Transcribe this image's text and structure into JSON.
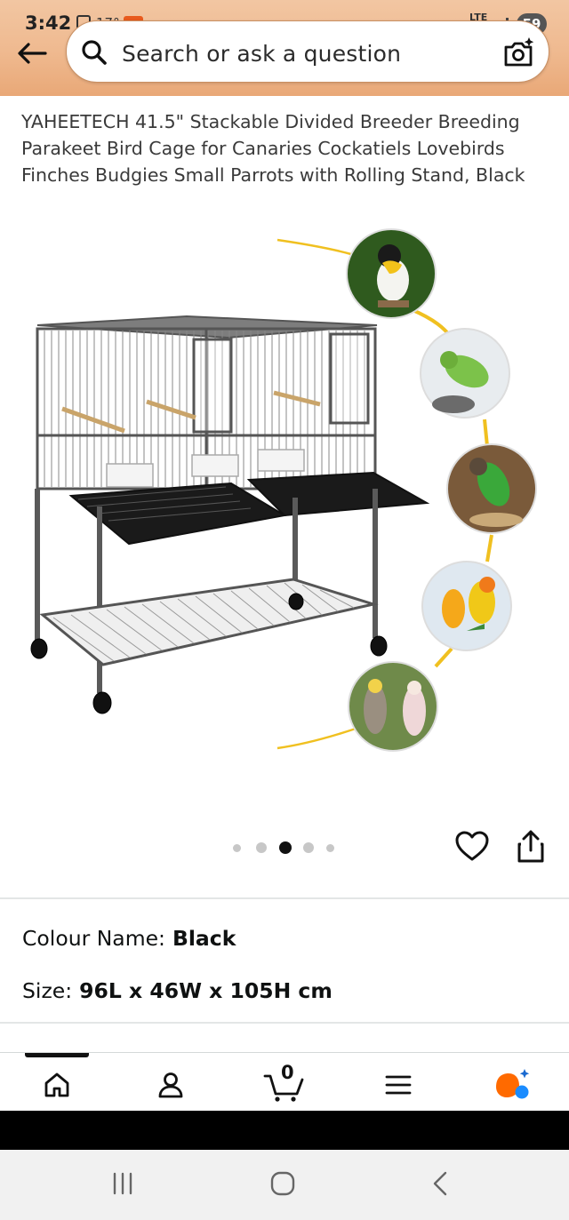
{
  "status_bar": {
    "time": "3:42",
    "temperature": "17°",
    "network": "LTE",
    "battery": "59"
  },
  "search": {
    "placeholder": "Search or ask a question"
  },
  "product": {
    "title": "YAHEETECH 41.5\" Stackable Divided Breeder Breeding Parakeet Bird Cage for Canaries Cockatiels Lovebirds Finches Budgies Small Parrots with Rolling Stand, Black",
    "image_count": 5,
    "active_image_index": 3
  },
  "variations": {
    "colour_label": "Colour Name:",
    "colour_value": "Black",
    "size_label": "Size:",
    "size_value": "96L x 46W x 105H cm"
  },
  "cart": {
    "count": "0"
  },
  "bottom_nav": {
    "items": [
      "home-icon",
      "account-icon",
      "cart-icon",
      "menu-icon",
      "rufus-ai-icon"
    ]
  },
  "colors": {
    "header_gradient_top": "#f2c6a2",
    "header_gradient_bottom": "#e9a877",
    "accent_orange": "#ff6a00",
    "accent_blue": "#1a8cff",
    "bird_line": "#f0c020"
  }
}
